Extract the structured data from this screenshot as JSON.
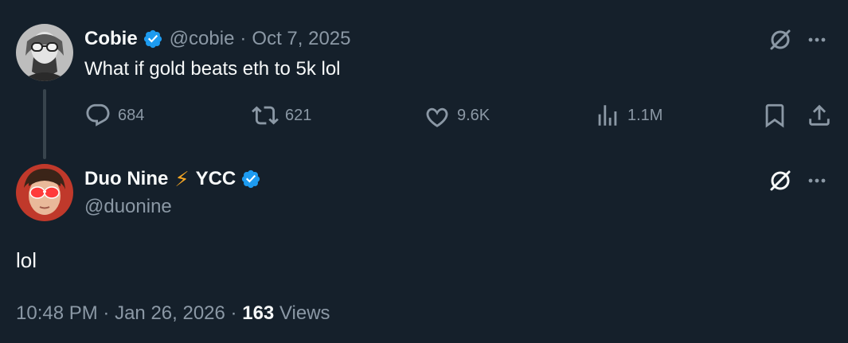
{
  "parent_tweet": {
    "name": "Cobie",
    "handle": "@cobie",
    "date": "Oct 7, 2025",
    "text": "What if gold beats eth to 5k lol",
    "stats": {
      "replies": "684",
      "reposts": "621",
      "likes": "9.6K",
      "views": "1.1M"
    }
  },
  "reply_tweet": {
    "name": "Duo Nine",
    "name_suffix": "YCC",
    "emoji": "⚡",
    "handle": "@duonine",
    "text": "lol",
    "time": "10:48 PM",
    "date": "Jan 26, 2026",
    "views_count": "163",
    "views_label": "Views"
  },
  "separator": "·",
  "icons": {
    "grok": "grok-icon",
    "more": "more-icon",
    "reply": "reply-icon",
    "repost": "repost-icon",
    "like": "heart-icon",
    "views": "views-icon",
    "bookmark": "bookmark-icon",
    "share": "share-icon",
    "verified": "verified-badge-icon"
  },
  "colors": {
    "background": "#15202b",
    "text_primary": "#f7f9f9",
    "text_secondary": "#8b98a5",
    "verified": "#1d9bf0",
    "thread_line": "#38444d"
  }
}
